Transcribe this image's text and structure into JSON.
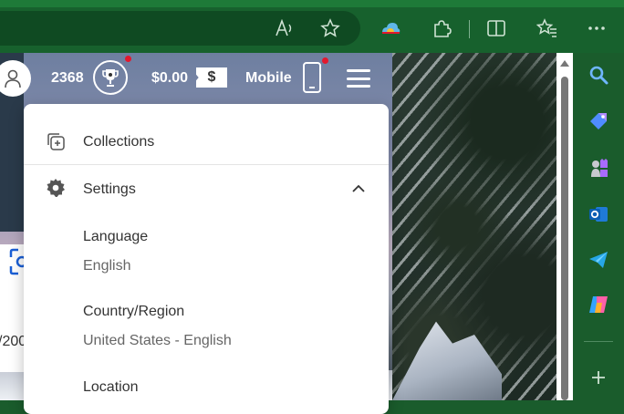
{
  "browser": {
    "icons": [
      "read-aloud-icon",
      "favorite-star-icon",
      "browser-essentials-icon",
      "extensions-icon",
      "split-screen-icon",
      "favorites-icon",
      "more-options-icon"
    ]
  },
  "header": {
    "points": "2368",
    "balance": "$0.00",
    "dollar_symbol": "$",
    "mobile_label": "Mobile"
  },
  "page": {
    "partial_text": "/200"
  },
  "menu": {
    "collections": "Collections",
    "settings": "Settings",
    "language_label": "Language",
    "language_value": "English",
    "country_label": "Country/Region",
    "country_value": "United States - English",
    "location_label": "Location"
  },
  "sidebar": {
    "icons": [
      "search-icon",
      "shopping-tag-icon",
      "games-chess-icon",
      "outlook-icon",
      "telegram-send-icon",
      "copilot-icon",
      "add-icon"
    ]
  },
  "colors": {
    "browser_green": "#17612d",
    "notification_red": "#e3182d"
  }
}
